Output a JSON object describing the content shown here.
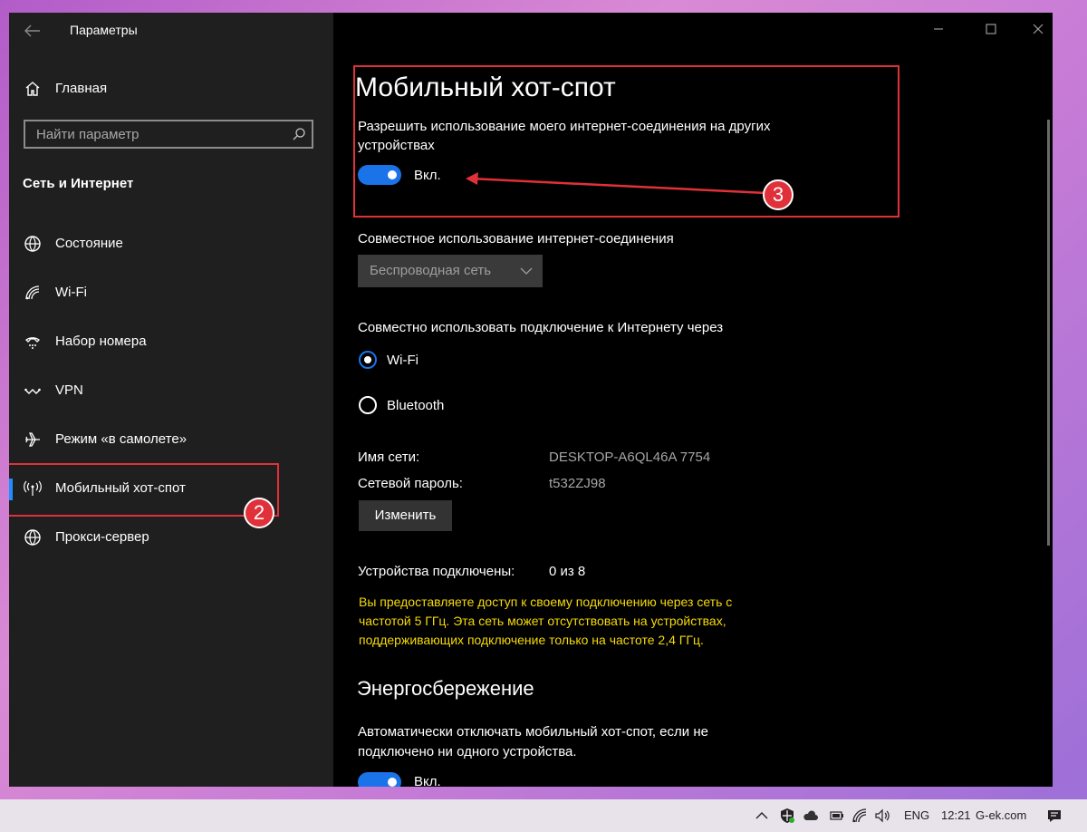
{
  "window": {
    "app_title": "Параметры"
  },
  "sidebar": {
    "home_label": "Главная",
    "search_placeholder": "Найти параметр",
    "section_title": "Сеть и Интернет",
    "items": [
      {
        "label": "Состояние",
        "icon": "globe-status-icon"
      },
      {
        "label": "Wi-Fi",
        "icon": "wifi-icon"
      },
      {
        "label": "Набор номера",
        "icon": "dialup-icon"
      },
      {
        "label": "VPN",
        "icon": "vpn-icon"
      },
      {
        "label": "Режим «в самолете»",
        "icon": "airplane-icon"
      },
      {
        "label": "Мобильный хот-спот",
        "icon": "hotspot-icon",
        "active": true
      },
      {
        "label": "Прокси-сервер",
        "icon": "globe-icon"
      }
    ],
    "badge": "2"
  },
  "main": {
    "title": "Мобильный хот-спот",
    "allow_sharing_desc_line1": "Разрешить использование моего интернет-соединения на других",
    "allow_sharing_desc_line2": "устройствах",
    "allow_sharing_toggle_label": "Вкл.",
    "badge": "3",
    "share_connection_label": "Совместное использование интернет-соединения",
    "share_connection_value": "Беспроводная сеть",
    "share_over_label": "Совместно использовать подключение к Интернету через",
    "share_over_options": [
      {
        "label": "Wi-Fi",
        "checked": true
      },
      {
        "label": "Bluetooth",
        "checked": false
      }
    ],
    "network_name_label": "Имя сети:",
    "network_name_value": "DESKTOP-A6QL46A 7754",
    "network_password_label": "Сетевой пароль:",
    "network_password_value": "t532ZJ98",
    "edit_button": "Изменить",
    "devices_connected_label": "Устройства подключены:",
    "devices_connected_value": "0 из 8",
    "warning_line1": "Вы предоставляете доступ к своему подключению через сеть с",
    "warning_line2": "частотой 5 ГГц. Эта сеть может отсутствовать на устройствах,",
    "warning_line3": "поддерживающих подключение только на частоте 2,4 ГГц.",
    "power_saving_title": "Энергосбережение",
    "power_saving_desc_line1": "Автоматически отключать мобильный хот-спот, если не",
    "power_saving_desc_line2": "подключено ни одного устройства.",
    "power_saving_toggle_label": "Вкл."
  },
  "taskbar": {
    "language": "ENG",
    "time": "12:21",
    "watermark": "G-ek.com"
  },
  "colors": {
    "accent": "#1a73e8",
    "annotation_red": "#e0313a",
    "warning_yellow": "#f5d90a"
  }
}
